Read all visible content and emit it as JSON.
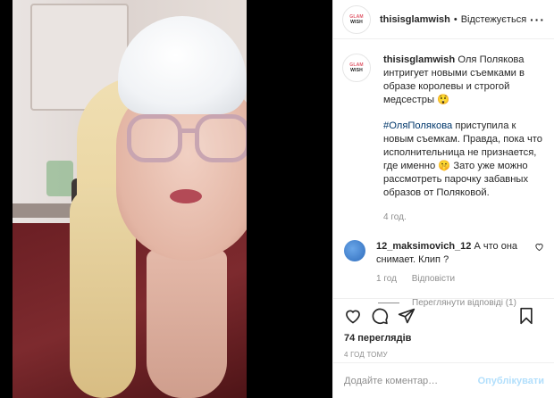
{
  "header": {
    "avatar_line1": "GLAM",
    "avatar_line2": "WISH",
    "username": "thisisglamwish",
    "separator": "•",
    "follow_label": "Відстежується",
    "more_label": "···"
  },
  "caption": {
    "username": "thisisglamwish",
    "para1": "Оля Полякова интригует новыми съемками в образе королевы и строгой медсестры 😲",
    "hashtag": "#ОляПолякова",
    "para2": "приступила к новым съемкам. Правда, пока что исполнительница не признается, где именно 🤫 Зато уже можно рассмотреть парочку забавных образов от Поляковой.",
    "time_ago": "4 год."
  },
  "comment": {
    "username": "12_maksimovich_12",
    "text": "А что она снимает. Клип ?",
    "time": "1 год",
    "reply_label": "Відповісти",
    "view_replies": "Переглянути відповіді (1)"
  },
  "actions": {
    "views": "74 переглядів",
    "posted_ago": "4 ГОД ТОМУ"
  },
  "add_comment": {
    "placeholder": "Додайте коментар…",
    "post_label": "Опублікувати"
  },
  "icons": [
    "heart-icon",
    "comment-icon",
    "share-icon",
    "bookmark-icon",
    "more-icon",
    "heart-small-icon"
  ]
}
